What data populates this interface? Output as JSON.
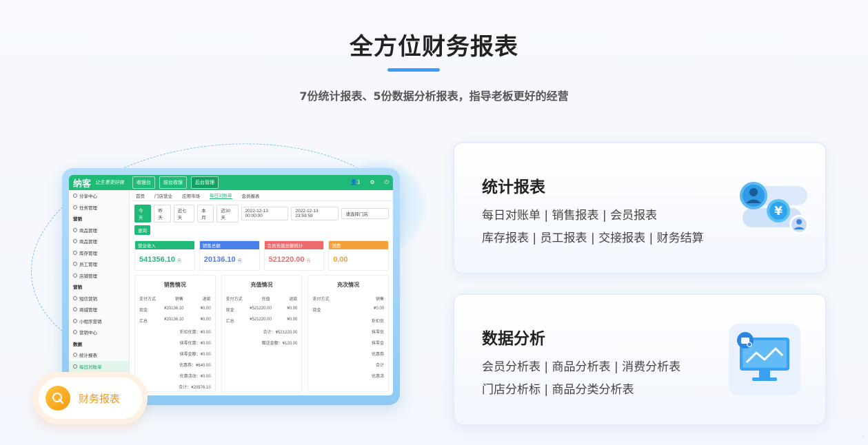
{
  "header": {
    "title": "全方位财务报表",
    "subtitle": "7份统计报表、5份数据分析报表，指导老板更好的经营"
  },
  "mockup": {
    "logo": "纳客",
    "slogan": "让生意更好做",
    "top_tabs": [
      "收银台",
      "前台收银",
      "后台管理"
    ],
    "user_count": "1",
    "page_tabs": [
      "首页",
      "门店营业",
      "应用市场",
      "每日对账单",
      "会员报表"
    ],
    "sidebar": [
      {
        "label": "分享中心",
        "group": false
      },
      {
        "label": "任务管理",
        "group": false
      },
      {
        "label": "营销",
        "group": true
      },
      {
        "label": "商品管理",
        "group": false
      },
      {
        "label": "商品管理",
        "group": false
      },
      {
        "label": "库存管理",
        "group": false
      },
      {
        "label": "员工管理",
        "group": false
      },
      {
        "label": "店铺管理",
        "group": false
      },
      {
        "label": "营销",
        "group": true
      },
      {
        "label": "短信营销",
        "group": false
      },
      {
        "label": "商城管理",
        "group": false
      },
      {
        "label": "小程序营销",
        "group": false
      },
      {
        "label": "营销中心",
        "group": false
      },
      {
        "label": "数据",
        "group": true
      },
      {
        "label": "统计报表",
        "group": false
      },
      {
        "label": "每日对账单",
        "group": false,
        "active": true
      }
    ],
    "filters": {
      "buttons": [
        "今天",
        "昨天",
        "近七天",
        "本月",
        "近30天"
      ],
      "start": "2022-12-13 00:00:00",
      "end": "2022-12-13 23:59:59",
      "store": "请选择门店",
      "query": "查询"
    },
    "cards": [
      {
        "title": "营业收入",
        "value": "541356.10",
        "unit": "元",
        "color": "#1fb978"
      },
      {
        "title": "销售总额",
        "value": "20136.10",
        "unit": "元",
        "color": "#4a7ee8"
      },
      {
        "title": "会员充值总额统计",
        "value": "521220.00",
        "unit": "元",
        "color": "#ee6b6b"
      },
      {
        "title": "消费",
        "value": "0.00",
        "unit": "",
        "color": "#f3a23a"
      }
    ],
    "panels": [
      {
        "title": "销售情况",
        "head": [
          "支付方式",
          "销售",
          "退款"
        ],
        "rows": [
          [
            "现金",
            "¥20136.10",
            "¥0.00"
          ],
          [
            "汇总",
            "¥20136.10",
            "¥0.00"
          ]
        ],
        "extra": [
          "折扣优惠：¥0.00",
          "抹零优惠：¥0.00",
          "抹零金额：¥0.00",
          "优惠券：¥640.00",
          "优惠活动：¥0.00",
          "合计：¥20976.10"
        ]
      },
      {
        "title": "充值情况",
        "head": [
          "支付方式",
          "充值",
          "退款"
        ],
        "rows": [
          [
            "现金",
            "¥521220.00",
            "¥0.00"
          ],
          [
            "汇总",
            "¥521220.00",
            "¥0.00"
          ]
        ],
        "extra": [
          "合计：¥521220.00",
          "赠送金额：¥120.00"
        ]
      },
      {
        "title": "充次情况",
        "head": [
          "支付方式",
          "销售"
        ],
        "rows": [
          [
            "现金",
            "¥0.00"
          ]
        ],
        "extra": [
          "折扣优",
          "抹零优",
          "抹零金",
          "优惠券",
          "合计",
          "优惠活"
        ]
      }
    ],
    "badge_label": "财务报表"
  },
  "features": [
    {
      "title": "统计报表",
      "line1": "每日对账单 | 销售报表 | 会员报表",
      "line2": "库存报表 | 员工报表 | 交接报表 | 财务结算",
      "icon": "user-finance-icon"
    },
    {
      "title": "数据分析",
      "line1": "会员分析表 | 商品分析表 | 消费分析表",
      "line2": "门店分析标 | 商品分类分析表",
      "icon": "analytics-monitor-icon"
    }
  ]
}
